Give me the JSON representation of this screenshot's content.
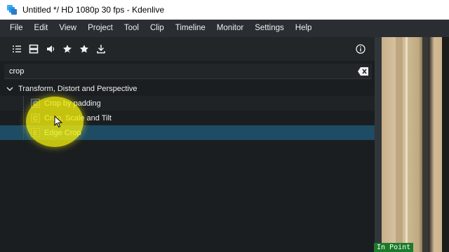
{
  "window": {
    "title": "Untitled */ HD 1080p 30 fps - Kdenlive"
  },
  "menubar": {
    "items": [
      "File",
      "Edit",
      "View",
      "Project",
      "Tool",
      "Clip",
      "Timeline",
      "Monitor",
      "Settings",
      "Help"
    ]
  },
  "effects_panel": {
    "toolbar": {
      "icons": [
        "list-icon",
        "video-icon",
        "audio-icon",
        "custom-effect-icon",
        "favorite-star-icon",
        "download-icon"
      ],
      "info_icon": "info-icon"
    },
    "search": {
      "value": "crop",
      "placeholder": ""
    },
    "tree": {
      "group_label": "Transform, Distort and Perspective",
      "items": [
        {
          "label": "Crop by padding",
          "icon_letter": "C"
        },
        {
          "label": "Crop, Scale and Tilt",
          "icon_letter": "C"
        },
        {
          "label": "Edge Crop",
          "icon_letter": "E"
        }
      ],
      "selected_index": 2
    }
  },
  "monitor": {
    "in_point_label": "In Point"
  },
  "colors": {
    "selection": "#1d4c64",
    "highlight": "#f5f00a",
    "in_point_bg": "#1a7a2a"
  }
}
